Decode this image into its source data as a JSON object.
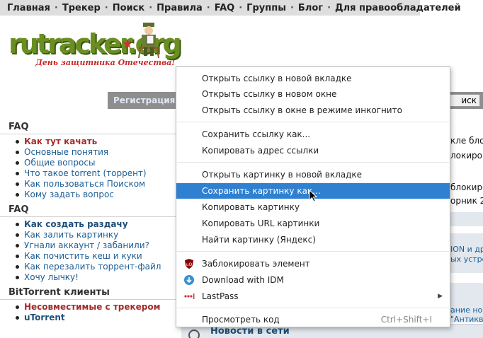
{
  "topnav": {
    "items": [
      "Главная",
      "Трекер",
      "Поиск",
      "Правила",
      "FAQ",
      "Группы",
      "Блог",
      "Для правообладателей"
    ],
    "separator": "·"
  },
  "logo": {
    "text": "rutracker.org",
    "subtitle": "День защитника Отечества!"
  },
  "regbar": {
    "register_label": "Регистрация",
    "search_label": "иск"
  },
  "sidebar": {
    "sections": [
      {
        "title": "FAQ",
        "items": [
          {
            "label": "Как тут качать",
            "style": "bold red"
          },
          {
            "label": "Основные понятия",
            "style": ""
          },
          {
            "label": "Общие вопросы",
            "style": ""
          },
          {
            "label": "Что такое torrent (торрент)",
            "style": ""
          },
          {
            "label": "Как пользоваться Поиском",
            "style": ""
          },
          {
            "label": "Кому задать вопрос",
            "style": ""
          }
        ]
      },
      {
        "title": "FAQ",
        "items": [
          {
            "label": "Как создать раздачу",
            "style": "bold navy"
          },
          {
            "label": "Как залить картинку",
            "style": ""
          },
          {
            "label": "Угнали аккаунт / забанили?",
            "style": ""
          },
          {
            "label": "Как почистить кеш и куки",
            "style": ""
          },
          {
            "label": "Как перезалить торрент-файл",
            "style": ""
          },
          {
            "label": "Хочу лычку!",
            "style": ""
          }
        ]
      },
      {
        "title": "BitTorrent клиенты",
        "items": [
          {
            "label": "Несовместимые с трекером",
            "style": "bold red"
          },
          {
            "label": "uTorrent",
            "style": "bold navy"
          }
        ]
      }
    ]
  },
  "right_fragments": {
    "t1": "кле блок",
    "t2": "локирова",
    "t3": "блокиро",
    "t4": "орник 2",
    "t5": "ION и др",
    "t6": "ых устро",
    "t7": "ание ново",
    "t8": "\"Антикв"
  },
  "news": {
    "title": "Новости в сети"
  },
  "context_menu": {
    "items": [
      {
        "label": "Открыть ссылку в новой вкладке"
      },
      {
        "label": "Открыть ссылку в новом окне"
      },
      {
        "label": "Открыть ссылку в окне в режиме инкогнито"
      },
      {
        "label": "Сохранить ссылку как..."
      },
      {
        "label": "Копировать адрес ссылки"
      },
      {
        "label": "Открыть картинку в новой вкладке"
      },
      {
        "label": "Сохранить картинку как..."
      },
      {
        "label": "Копировать картинку"
      },
      {
        "label": "Копировать URL картинки"
      },
      {
        "label": "Найти картинку (Яндекс)"
      },
      {
        "label": "Заблокировать элемент",
        "icon": "ublock-icon"
      },
      {
        "label": "Download with IDM",
        "icon": "idm-icon"
      },
      {
        "label": "LastPass",
        "icon": "lastpass-icon"
      },
      {
        "label": "Просмотреть код",
        "shortcut": "Ctrl+Shift+I"
      }
    ],
    "highlight_color": "#2f80d1"
  }
}
